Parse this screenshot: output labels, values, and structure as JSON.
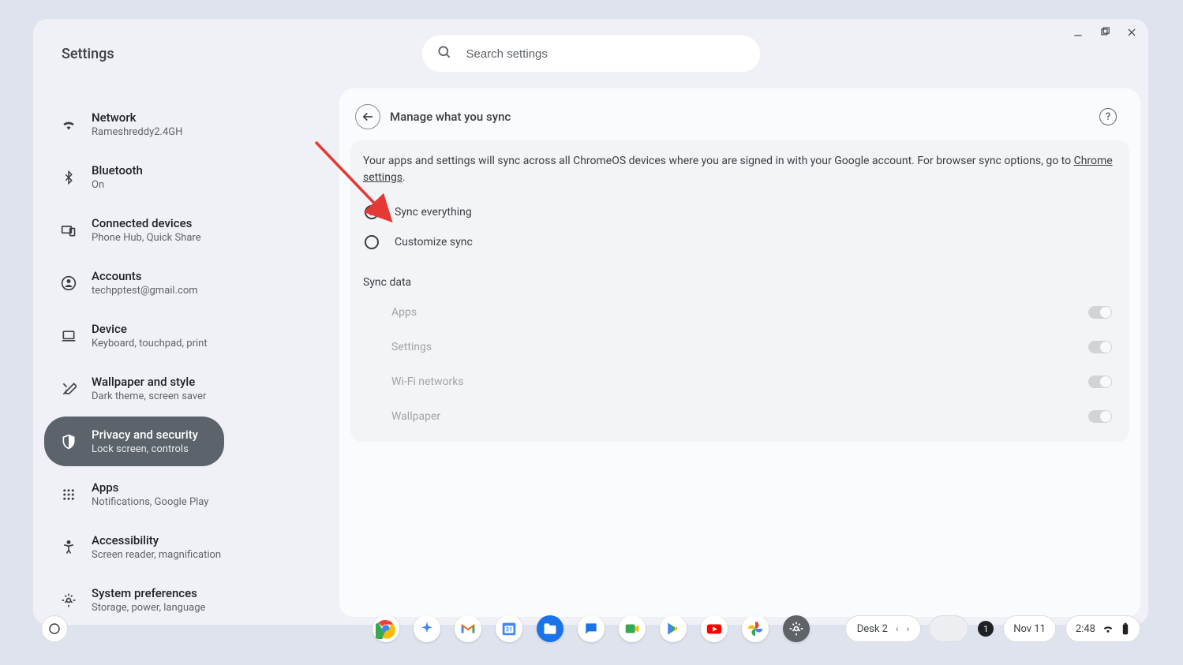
{
  "page_title": "Settings",
  "search": {
    "placeholder": "Search settings"
  },
  "window_controls": {
    "minimize": "–",
    "maximize": "❐",
    "close": "✕"
  },
  "sidebar": {
    "items": [
      {
        "id": "network",
        "label": "Network",
        "sub": "Rameshreddy2.4GH"
      },
      {
        "id": "bluetooth",
        "label": "Bluetooth",
        "sub": "On"
      },
      {
        "id": "connected-devices",
        "label": "Connected devices",
        "sub": "Phone Hub, Quick Share"
      },
      {
        "id": "accounts",
        "label": "Accounts",
        "sub": "techpptest@gmail.com"
      },
      {
        "id": "device",
        "label": "Device",
        "sub": "Keyboard, touchpad, print"
      },
      {
        "id": "wallpaper-style",
        "label": "Wallpaper and style",
        "sub": "Dark theme, screen saver"
      },
      {
        "id": "privacy-security",
        "label": "Privacy and security",
        "sub": "Lock screen, controls"
      },
      {
        "id": "apps",
        "label": "Apps",
        "sub": "Notifications, Google Play"
      },
      {
        "id": "accessibility",
        "label": "Accessibility",
        "sub": "Screen reader, magnification"
      },
      {
        "id": "system-preferences",
        "label": "System preferences",
        "sub": "Storage, power, language"
      }
    ]
  },
  "main": {
    "title": "Manage what you sync",
    "description_prefix": "Your apps and settings will sync across all ChromeOS devices where you are signed in with your Google account. For browser sync options, go to ",
    "description_link": "Chrome settings",
    "description_suffix": ".",
    "radio_sync_everything": "Sync everything",
    "radio_customize_sync": "Customize sync",
    "section_title": "Sync data",
    "toggles": [
      {
        "label": "Apps",
        "on": true
      },
      {
        "label": "Settings",
        "on": true
      },
      {
        "label": "Wi-Fi networks",
        "on": true
      },
      {
        "label": "Wallpaper",
        "on": true
      }
    ],
    "help": "?"
  },
  "shelf": {
    "desk_label": "Desk 2",
    "date": "Nov 11",
    "time": "2:48",
    "notif_count": "1"
  }
}
